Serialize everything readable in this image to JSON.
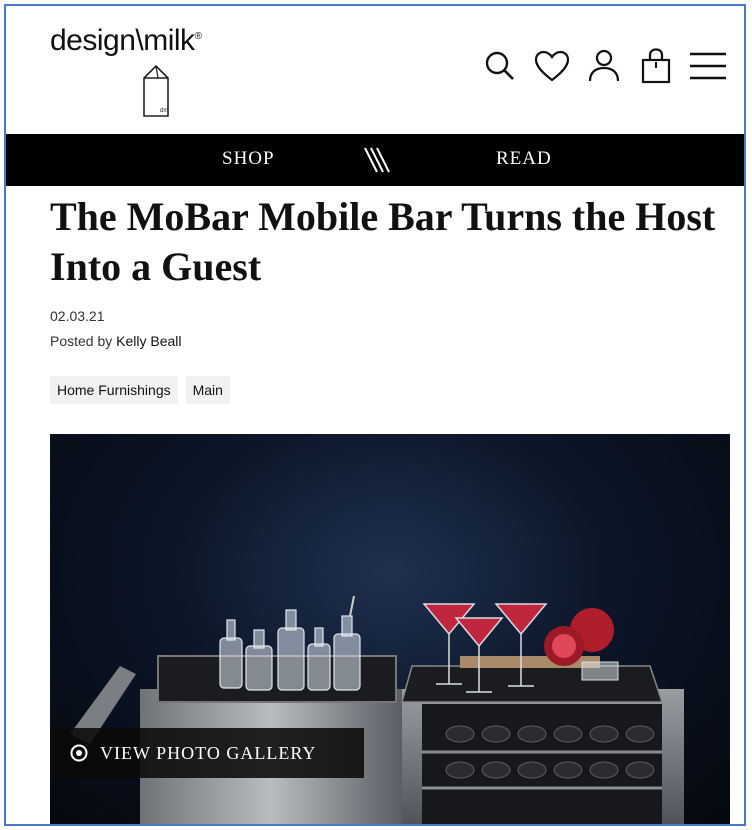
{
  "brand": {
    "logo_text": "design\\milk",
    "registered": "®",
    "carton_mark": "dm"
  },
  "header": {
    "icons": [
      "search-icon",
      "heart-icon",
      "user-icon",
      "shopping-bag-icon",
      "hamburger-menu-icon"
    ]
  },
  "nav": {
    "shop": "SHOP",
    "read": "READ"
  },
  "article": {
    "title": "The MoBar Mobile Bar Turns the Host Into a Guest",
    "date": "02.03.21",
    "posted_by_prefix": "Posted by ",
    "author": "Kelly Beall",
    "tags": [
      "Home Furnishings",
      "Main"
    ]
  },
  "hero": {
    "gallery_label": "VIEW PHOTO GALLERY",
    "gallery_icon": "target-circle-icon"
  },
  "colors": {
    "nav_bg": "#000000",
    "frame_border": "#4a78c4",
    "tag_bg": "#f1f1f1"
  }
}
